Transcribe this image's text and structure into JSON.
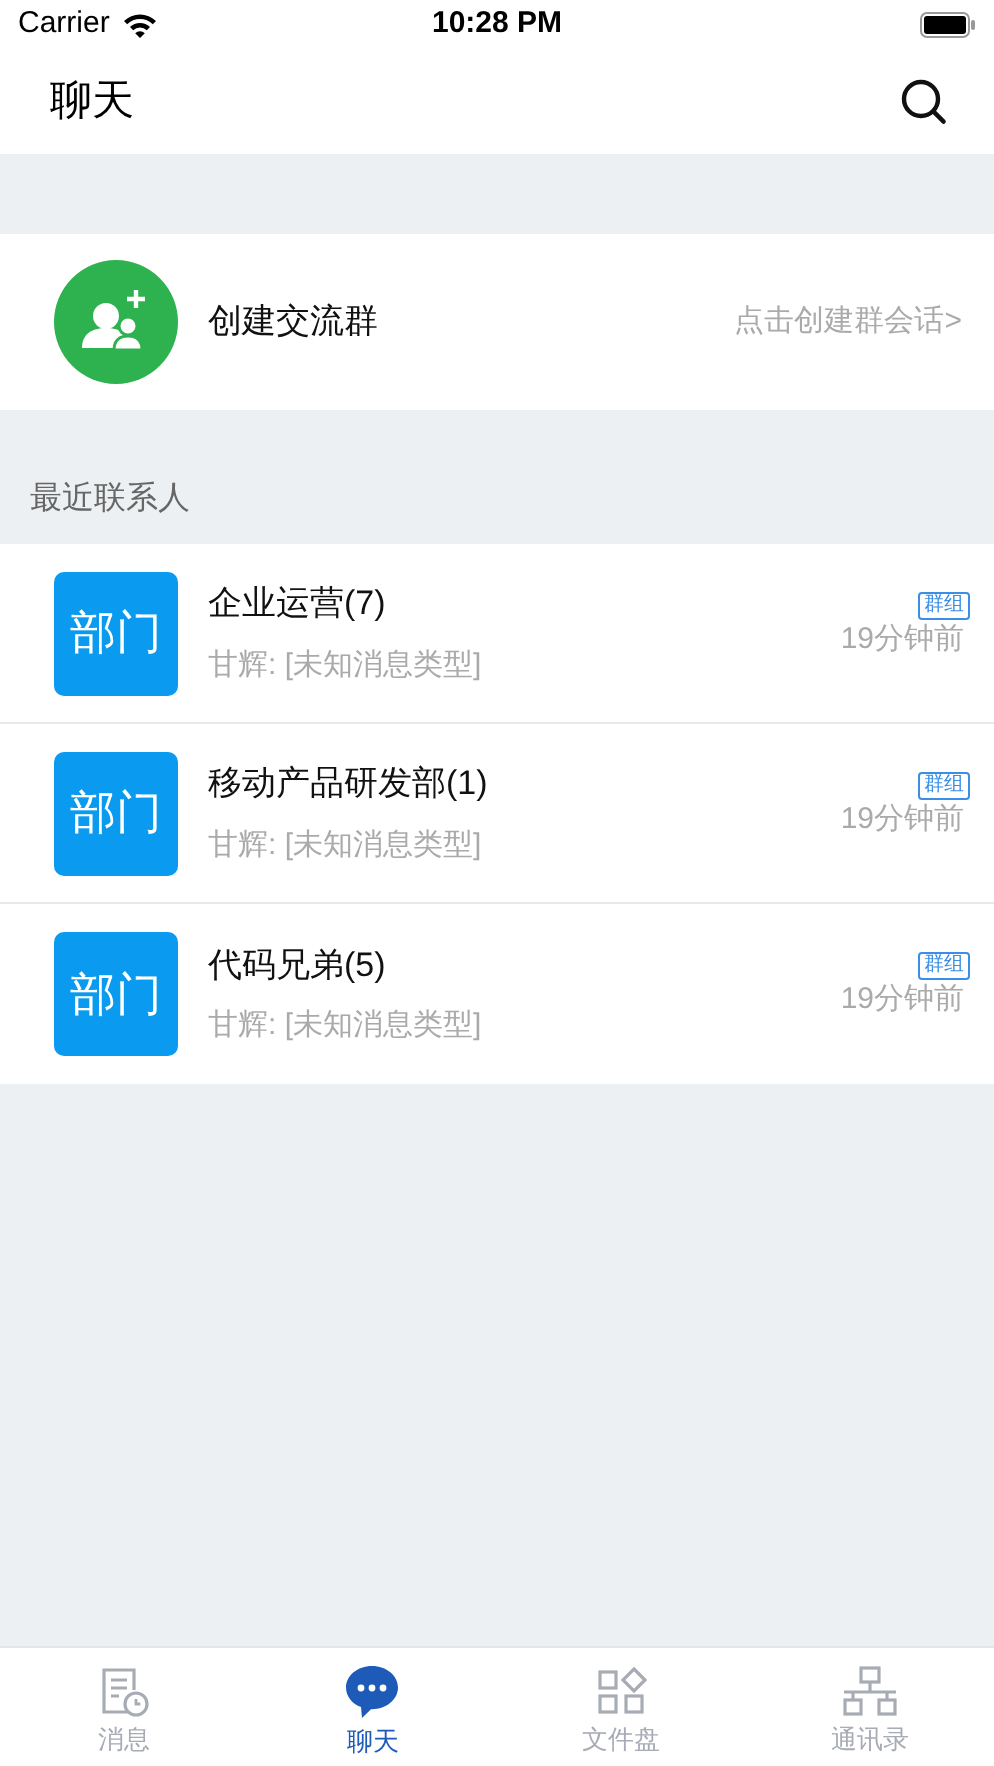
{
  "status_bar": {
    "carrier": "Carrier",
    "time": "10:28 PM"
  },
  "nav": {
    "title": "聊天"
  },
  "create_group": {
    "title": "创建交流群",
    "hint": "点击创建群会话>"
  },
  "section_label": "最近联系人",
  "conversations": [
    {
      "avatar": "部门",
      "name": "企业运营(7)",
      "preview": "甘辉: [未知消息类型]",
      "tag": "群组",
      "time": "19分钟前"
    },
    {
      "avatar": "部门",
      "name": "移动产品研发部(1)",
      "preview": "甘辉: [未知消息类型]",
      "tag": "群组",
      "time": "19分钟前"
    },
    {
      "avatar": "部门",
      "name": "代码兄弟(5)",
      "preview": "甘辉: [未知消息类型]",
      "tag": "群组",
      "time": "19分钟前"
    }
  ],
  "tabs": [
    {
      "label": "消息",
      "selected": false
    },
    {
      "label": "聊天",
      "selected": true
    },
    {
      "label": "文件盘",
      "selected": false
    },
    {
      "label": "通讯录",
      "selected": false
    }
  ]
}
